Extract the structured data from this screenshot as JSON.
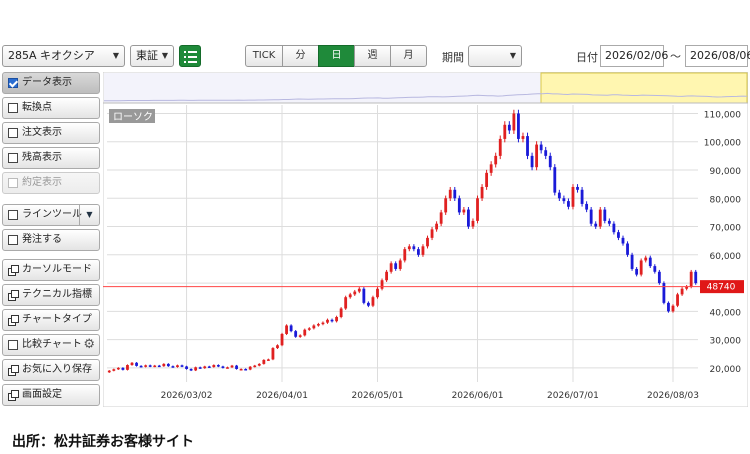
{
  "toolbar": {
    "symbol": "285A キオクシア",
    "market": "東証",
    "intervals": [
      "TICK",
      "分",
      "日",
      "週",
      "月"
    ],
    "active_interval": "日",
    "period_label": "期間",
    "period_value": "",
    "date_label": "日付",
    "date_from": "2026/02/06",
    "date_sep": "～",
    "date_to": "2026/08/06"
  },
  "sidebar": {
    "items": [
      {
        "label": "データ表示",
        "control": "checkbox",
        "checked": true
      },
      {
        "label": "転換点",
        "control": "checkbox",
        "checked": false
      },
      {
        "label": "注文表示",
        "control": "checkbox",
        "checked": false
      },
      {
        "label": "残高表示",
        "control": "checkbox",
        "checked": false
      },
      {
        "label": "約定表示",
        "control": "checkbox",
        "checked": false,
        "disabled": true
      },
      {
        "label": "ラインツール",
        "control": "checkbox",
        "checked": false
      },
      {
        "label": "発注する",
        "control": "checkbox",
        "checked": false
      },
      {
        "label": "カーソルモード",
        "control": "window-icon"
      },
      {
        "label": "テクニカル指標",
        "control": "window-icon"
      },
      {
        "label": "チャートタイプ",
        "control": "window-icon"
      },
      {
        "label": "比較チャート",
        "control": "checkbox",
        "checked": false
      },
      {
        "label": "お気に入り保存",
        "control": "window-icon"
      },
      {
        "label": "画面設定",
        "control": "window-icon"
      }
    ]
  },
  "chart": {
    "tag": "ローソク",
    "price_badge": "48740",
    "colors": {
      "up": "#e02020",
      "down": "#1a1ad8",
      "line": "#ff4444",
      "navigator": "#fff6b0",
      "grid": "#dddddd"
    }
  },
  "chart_data": {
    "type": "candlestick",
    "y_ticks": [
      "110,000",
      "100,000",
      "90,000",
      "80,000",
      "70,000",
      "60,000",
      "50,000",
      "40,000",
      "30,000",
      "20,000"
    ],
    "ylim": [
      15000,
      113000
    ],
    "x_ticks": [
      "2026/03/02",
      "2026/04/01",
      "2026/05/01",
      "2026/06/01",
      "2026/07/01",
      "2026/08/03"
    ],
    "current_price": 48740,
    "closes": [
      19000,
      19500,
      20000,
      19300,
      21000,
      21800,
      20700,
      20400,
      20900,
      20500,
      20800,
      20600,
      21400,
      20600,
      20300,
      20900,
      20500,
      19600,
      19100,
      20200,
      19900,
      20500,
      20300,
      21000,
      20500,
      20000,
      20200,
      20800,
      19600,
      19600,
      19400,
      20400,
      20800,
      21400,
      22800,
      23000,
      27000,
      28000,
      32000,
      35000,
      33000,
      31000,
      31500,
      33500,
      34000,
      35000,
      35500,
      36000,
      37000,
      36500,
      38000,
      41000,
      45000,
      46000,
      47000,
      48000,
      43000,
      42000,
      45000,
      48000,
      51000,
      54000,
      57000,
      55000,
      58000,
      62000,
      63000,
      62000,
      60000,
      63000,
      66000,
      69000,
      71000,
      75000,
      80000,
      83000,
      80000,
      75000,
      76000,
      70000,
      72000,
      80000,
      84000,
      89000,
      92000,
      95000,
      101000,
      106000,
      104000,
      110000,
      101000,
      102000,
      95000,
      91000,
      99000,
      97000,
      95000,
      91000,
      82000,
      80000,
      79000,
      77000,
      84000,
      83000,
      78000,
      76000,
      71000,
      70000,
      76000,
      72000,
      71000,
      68000,
      66000,
      64000,
      60000,
      55000,
      53000,
      58000,
      59000,
      56000,
      54000,
      50000,
      43000,
      40000,
      42000,
      46000,
      48000,
      48740,
      54000,
      50000
    ]
  }
}
